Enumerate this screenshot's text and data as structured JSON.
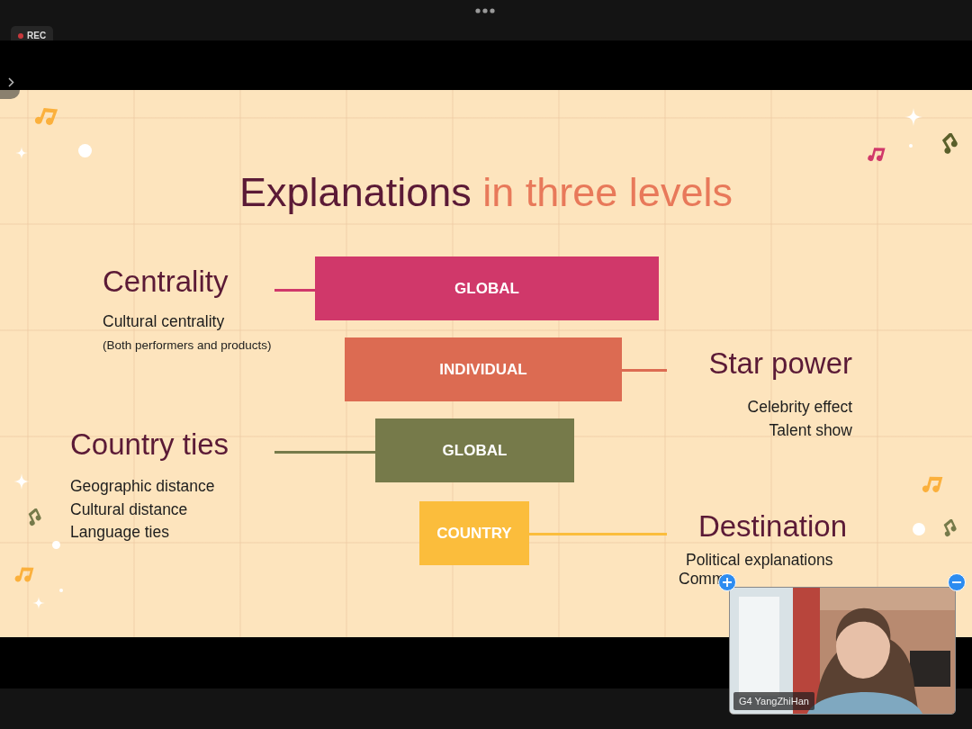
{
  "recording": {
    "label": "REC"
  },
  "slide": {
    "title": "Explanations",
    "title_accent": "in three levels",
    "levels": [
      {
        "label": "GLOBAL",
        "color": "#d0386a"
      },
      {
        "label": "INDIVIDUAL",
        "color": "#dc6b52"
      },
      {
        "label": "GLOBAL",
        "color": "#767a4a"
      },
      {
        "label": "COUNTRY",
        "color": "#fbbd3c"
      }
    ],
    "explanations": [
      {
        "heading": "Centrality",
        "lines": [
          "Cultural centrality"
        ],
        "note": "(Both performers and products)"
      },
      {
        "heading": "Star power",
        "lines": [
          "Celebrity effect",
          "Talent show"
        ]
      },
      {
        "heading": "Country ties",
        "lines": [
          "Geographic distance",
          "Cultural distance",
          "Language ties"
        ]
      },
      {
        "heading": "Destination",
        "lines": [
          "Political explanations",
          "Comm"
        ]
      }
    ]
  },
  "video": {
    "name": "G4 YangZhiHan"
  }
}
